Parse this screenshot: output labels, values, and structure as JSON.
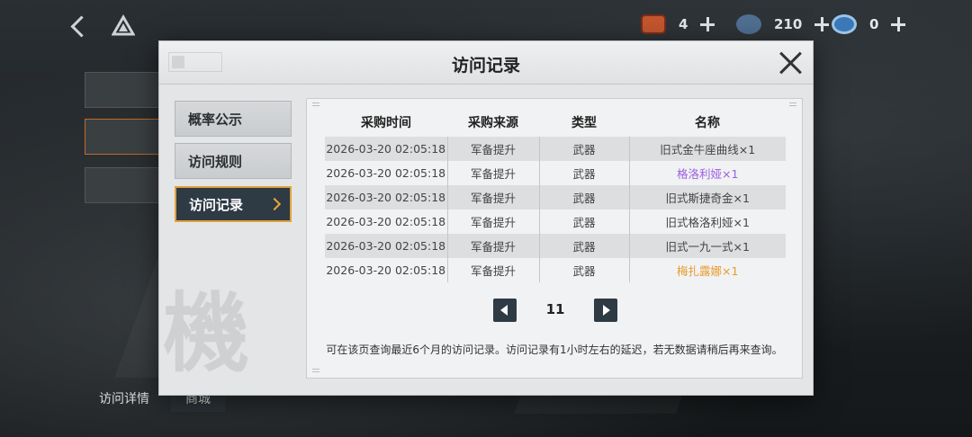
{
  "currencies": [
    {
      "value": "4",
      "color": "#c4562f"
    },
    {
      "value": "210",
      "color": "#4f6f92"
    },
    {
      "value": "0",
      "color": "#3a78b8"
    }
  ],
  "background": {
    "bottom_tabs": [
      "访问详情",
      "商城"
    ]
  },
  "modal": {
    "title": "访问记录",
    "nav": [
      "概率公示",
      "访问规则",
      "访问记录"
    ],
    "active_nav": 2,
    "watermark": "機",
    "table": {
      "headers": [
        "采购时间",
        "采购来源",
        "类型",
        "名称"
      ],
      "rows": [
        {
          "time": "2026-03-20 02:05:18",
          "source": "军备提升",
          "type": "武器",
          "name": "旧式金牛座曲线×1",
          "rarity": "normal"
        },
        {
          "time": "2026-03-20 02:05:18",
          "source": "军备提升",
          "type": "武器",
          "name": "格洛利娅×1",
          "rarity": "purple"
        },
        {
          "time": "2026-03-20 02:05:18",
          "source": "军备提升",
          "type": "武器",
          "name": "旧式斯捷奇金×1",
          "rarity": "normal"
        },
        {
          "time": "2026-03-20 02:05:18",
          "source": "军备提升",
          "type": "武器",
          "name": "旧式格洛利娅×1",
          "rarity": "normal"
        },
        {
          "time": "2026-03-20 02:05:18",
          "source": "军备提升",
          "type": "武器",
          "name": "旧式一九一式×1",
          "rarity": "normal"
        },
        {
          "time": "2026-03-20 02:05:18",
          "source": "军备提升",
          "type": "武器",
          "name": "梅扎露娜×1",
          "rarity": "gold"
        }
      ]
    },
    "page": "11",
    "notice": "可在该页查询最近6个月的访问记录。访问记录有1小时左右的延迟，若无数据请稍后再来查询。"
  },
  "colors": {
    "accent": "#e1a23a",
    "dark_button": "#2e3a44"
  }
}
